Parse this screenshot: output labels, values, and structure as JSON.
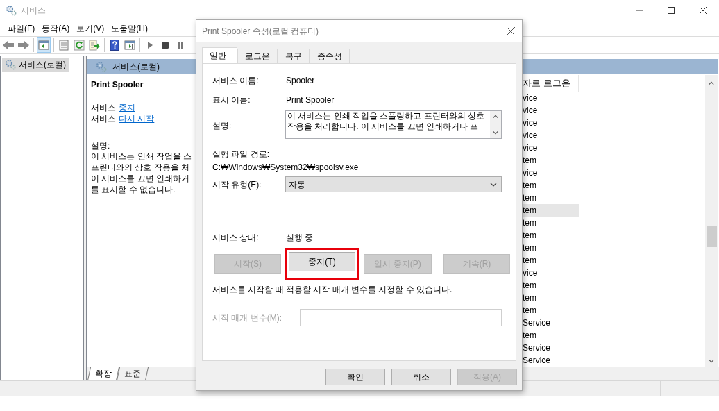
{
  "window": {
    "title": "서비스"
  },
  "menu": [
    "파일(F)",
    "동작(A)",
    "보기(V)",
    "도움말(H)"
  ],
  "toolbar": [
    {
      "kind": "back"
    },
    {
      "kind": "forward"
    },
    {
      "kind": "sep"
    },
    {
      "kind": "tree",
      "on": true
    },
    {
      "kind": "sep"
    },
    {
      "kind": "properties",
      "on": false
    },
    {
      "kind": "refresh"
    },
    {
      "kind": "export"
    },
    {
      "kind": "sep"
    },
    {
      "kind": "help"
    },
    {
      "kind": "pane",
      "on": false
    },
    {
      "kind": "sep"
    },
    {
      "kind": "play"
    },
    {
      "kind": "stop"
    },
    {
      "kind": "pause"
    }
  ],
  "tree": [
    {
      "label": "서비스(로컬)",
      "selected": true
    }
  ],
  "pane": {
    "title": "서비스(로컬)",
    "service_name": "Print Spooler",
    "actions": [
      {
        "prefix": "서비스",
        "link": "중지"
      },
      {
        "prefix": "서비스",
        "link": "다시 시작"
      }
    ],
    "description_label": "설명:",
    "description_lines": [
      "이 서비스는 인쇄 작업을 스",
      "프린터와의 상호 작용을 처",
      "이 서비스를 끄면 인쇄하거",
      "를 표시할 수 없습니다."
    ]
  },
  "list": {
    "column_header": "자로 로그온",
    "rows": [
      {
        "text": "vice",
        "selected": false
      },
      {
        "text": "vice",
        "selected": false
      },
      {
        "text": "vice",
        "selected": false
      },
      {
        "text": "vice",
        "selected": false
      },
      {
        "text": "vice",
        "selected": false
      },
      {
        "text": "tem",
        "selected": false
      },
      {
        "text": "vice",
        "selected": false
      },
      {
        "text": "tem",
        "selected": false
      },
      {
        "text": "tem",
        "selected": false
      },
      {
        "text": "tem",
        "selected": true
      },
      {
        "text": "tem",
        "selected": false
      },
      {
        "text": "tem",
        "selected": false
      },
      {
        "text": "tem",
        "selected": false
      },
      {
        "text": "tem",
        "selected": false
      },
      {
        "text": "vice",
        "selected": false
      },
      {
        "text": "tem",
        "selected": false
      },
      {
        "text": "tem",
        "selected": false
      },
      {
        "text": "tem",
        "selected": false
      },
      {
        "text": "Service",
        "selected": false
      },
      {
        "text": "tem",
        "selected": false
      },
      {
        "text": "Service",
        "selected": false
      },
      {
        "text": "Service",
        "selected": false
      }
    ]
  },
  "view_tabs": [
    {
      "label": "확장",
      "selected": true
    },
    {
      "label": "표준",
      "selected": false
    }
  ],
  "dialog": {
    "title": "Print Spooler 속성(로컬 컴퓨터)",
    "tabs": [
      {
        "label": "일반",
        "selected": true
      },
      {
        "label": "로그온",
        "selected": false
      },
      {
        "label": "복구",
        "selected": false
      },
      {
        "label": "종속성",
        "selected": false
      }
    ],
    "service_name_label": "서비스 이름:",
    "service_name": "Spooler",
    "display_name_label": "표시 이름:",
    "display_name": "Print Spooler",
    "description_label": "설명:",
    "description": "이 서비스는 인쇄 작업을 스풀링하고 프린터와의 상호 작용을 처리합니다. 이 서비스를 끄면 인쇄하거나 프",
    "path_label": "실행 파일 경로:",
    "path": "C:₩Windows₩System32₩spoolsv.exe",
    "startup_label": "시작 유형(E):",
    "startup_value": "자동",
    "status_label": "서비스 상태:",
    "status": "실행 중",
    "control_buttons": [
      {
        "label": "시작(S)",
        "disabled": true,
        "highlight": false
      },
      {
        "label": "중지(T)",
        "disabled": false,
        "highlight": true
      },
      {
        "label": "일시 중지(P)",
        "disabled": true,
        "highlight": false
      },
      {
        "label": "계속(R)",
        "disabled": true,
        "highlight": false
      }
    ],
    "hint": "서비스를 시작할 때 적용할 시작 매개 변수를 지정할 수 있습니다.",
    "params_label": "시작 매개 변수(M):",
    "params_disabled": true,
    "footer_buttons": [
      {
        "label": "확인",
        "disabled": false
      },
      {
        "label": "취소",
        "disabled": false
      },
      {
        "label": "적용(A)",
        "disabled": true
      }
    ]
  }
}
